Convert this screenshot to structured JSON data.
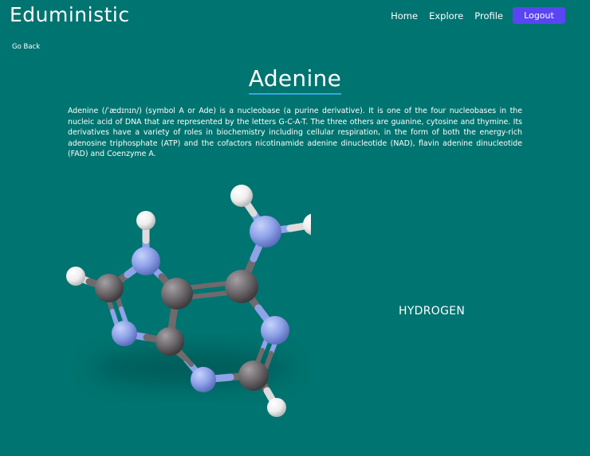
{
  "header": {
    "brand": "Eduministic",
    "nav": {
      "home": "Home",
      "explore": "Explore",
      "profile": "Profile",
      "logout": "Logout"
    }
  },
  "page": {
    "go_back": "Go Back",
    "title": "Adenine",
    "description": "Adenine (/ˈædɪnɪn/) (symbol A or Ade) is a nucleobase (a purine derivative). It is one of the four nucleobases in the nucleic acid of DNA that are represented by the letters G-C-A-T. The three others are guanine, cytosine and thymine. Its derivatives have a variety of roles in biochemistry including cellular respiration, in the form of both the energy-rich adenosine triphosphate (ATP) and the cofactors nicotinamide adenine dinucleotide (NAD), flavin adenine dinucleotide (FAD) and Coenzyme A.",
    "selected_element": "HYDROGEN"
  },
  "colors": {
    "background": "#007470",
    "accent": "#5a45f2",
    "title_underline": "#35a7e0",
    "carbon": "#6e6a6d",
    "nitrogen": "#8fa3e8",
    "hydrogen": "#f0f0f0"
  }
}
